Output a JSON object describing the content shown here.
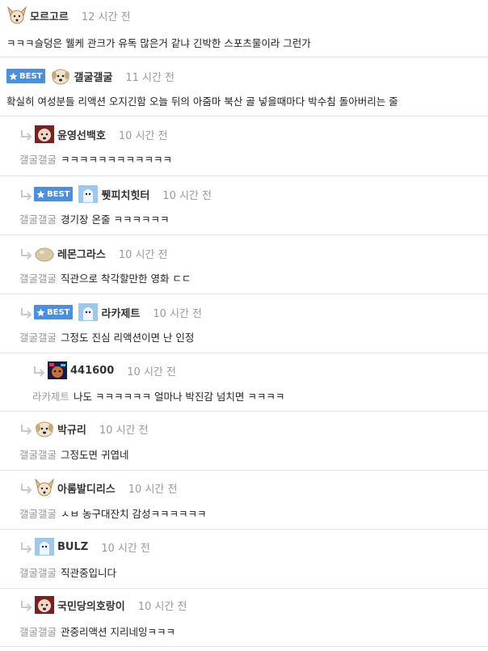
{
  "best_label": "BEST",
  "comments": [
    {
      "nick": "모르고르",
      "time": "12 시간 전",
      "text": "ㅋㅋㅋ슬덩은 웰케 관크가 유독 많은거 같냐 긴박한 스포츠물이라 그런가",
      "mention": "",
      "best": false,
      "reply": false,
      "avatar": "dog-ears-icon"
    },
    {
      "nick": "갤굴갤굴",
      "time": "11 시간 전",
      "text": "확실히 여성분들 리액션 오지긴함 오늘 뒤의 아줌마 북산 골 넣을때마다 박수침 돌아버리는 줄",
      "mention": "",
      "best": true,
      "reply": false,
      "avatar": "puppy-icon"
    },
    {
      "nick": "윤영선백호",
      "time": "10 시간 전",
      "text": "ㅋㅋㅋㅋㅋㅋㅋㅋㅋㅋㅋㅋ",
      "mention": "갤굴갤굴",
      "best": false,
      "reply": true,
      "avatar": "red-dog-icon"
    },
    {
      "nick": "퓃피치힛터",
      "time": "10 시간 전",
      "text": "경기장 온줄 ㅋㅋㅋㅋㅋㅋ",
      "mention": "갤굴갤굴",
      "best": true,
      "reply": true,
      "avatar": "blue-ghost-icon"
    },
    {
      "nick": "레몬그라스",
      "time": "10 시간 전",
      "text": "직관으로 착각할만한 영화 ㄷㄷ",
      "mention": "갤굴갤굴",
      "best": false,
      "reply": true,
      "avatar": "blob-icon"
    },
    {
      "nick": "라카제트",
      "time": "10 시간 전",
      "text": "그정도 진심 리액션이면 난 인정",
      "mention": "갤굴갤굴",
      "best": true,
      "reply": true,
      "avatar": "blue-ghost-icon"
    },
    {
      "nick": "441600",
      "time": "10 시간 전",
      "text": "나도 ㅋㅋㅋㅋㅋㅋ 얼마나 박진감 넘치면 ㅋㅋㅋㅋ",
      "mention": "라카제트",
      "best": false,
      "reply": true,
      "avatar": "glitch-dog-icon"
    },
    {
      "nick": "박규리",
      "time": "10 시간 전",
      "text": "그정도면 귀엽네",
      "mention": "갤굴갤굴",
      "best": false,
      "reply": true,
      "avatar": "puppy-icon"
    },
    {
      "nick": "아롬발디리스",
      "time": "10 시간 전",
      "text": "ㅅㅂ 농구대잔치 감성ㅋㅋㅋㅋㅋㅋ",
      "mention": "갤굴갤굴",
      "best": false,
      "reply": true,
      "avatar": "dog-ears-icon"
    },
    {
      "nick": "BULZ",
      "time": "10 시간 전",
      "text": "직관중입니다",
      "mention": "갤굴갤굴",
      "best": false,
      "reply": true,
      "avatar": "blue-ghost-icon"
    },
    {
      "nick": "국민당의호랑이",
      "time": "10 시간 전",
      "text": "관중리액션 지리네잉ㅋㅋㅋ",
      "mention": "갤굴갤굴",
      "best": false,
      "reply": true,
      "avatar": "red-dog-icon"
    }
  ],
  "colors": {
    "best_badge": "#4a8fe0",
    "time": "#999999",
    "mention": "#999999",
    "divider": "#e4e4e4"
  }
}
